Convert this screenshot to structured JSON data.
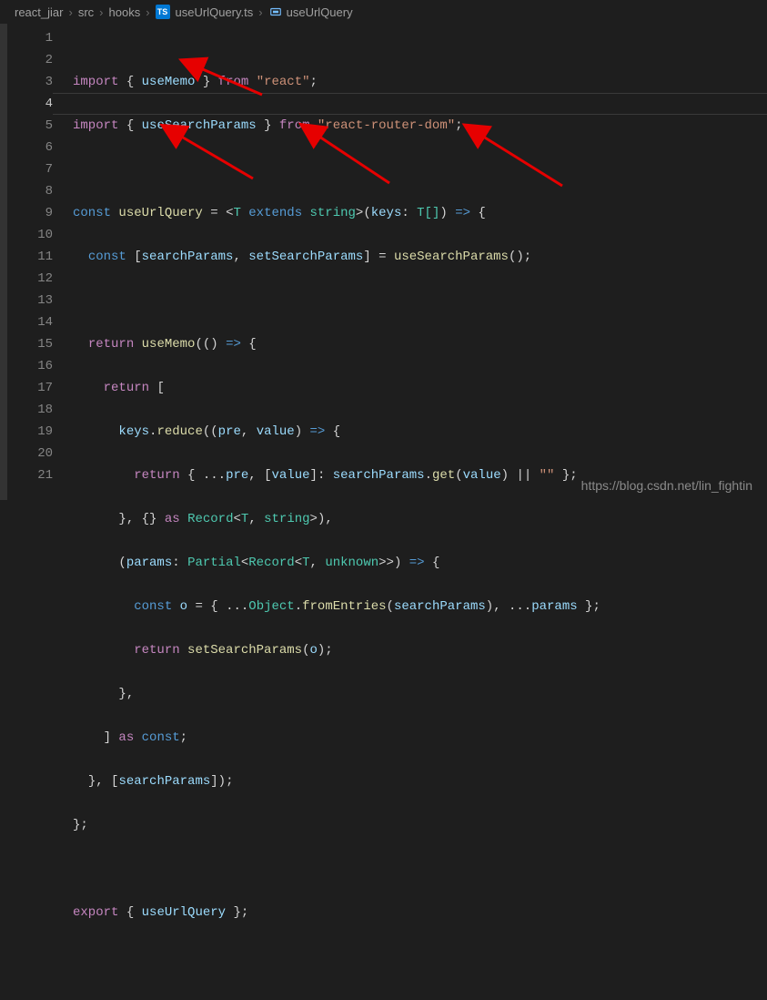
{
  "breadcrumb": {
    "parts": [
      "react_jiar",
      "src",
      "hooks"
    ],
    "file": "useUrlQuery.ts",
    "file_badge": "TS",
    "symbol": "useUrlQuery"
  },
  "active_line": 4,
  "lines": [
    "1",
    "2",
    "3",
    "4",
    "5",
    "6",
    "7",
    "8",
    "9",
    "10",
    "11",
    "12",
    "13",
    "14",
    "15",
    "16",
    "17",
    "18",
    "19",
    "20",
    "21"
  ],
  "t": {
    "import": "import",
    "from": "from",
    "const": "const",
    "return": "return",
    "extends": "extends",
    "as": "as",
    "export": "export",
    "ob": "{",
    "cb": "}",
    "osq": "[",
    "csq": "]",
    "op": "(",
    "cp": ")",
    "comma": ",",
    "semi": ";",
    "colon": ":",
    "arrow": "=>",
    "eq": "=",
    "lt": "<",
    "gt": ">",
    "spread": "...",
    "or": "||",
    "useMemo": "useMemo",
    "useSearchParams": "useSearchParams",
    "react": "\"react\"",
    "rrd": "\"react-router-dom\"",
    "useUrlQuery": "useUrlQuery",
    "T": "T",
    "string": "string",
    "keys": "keys",
    "Tarr": "T[]",
    "searchParams": "searchParams",
    "setSearchParams": "setSearchParams",
    "reduce": "reduce",
    "pre": "pre",
    "value": "value",
    "get": "get",
    "empty": "\"\"",
    "Record": "Record",
    "params": "params",
    "Partial": "Partial",
    "unknown": "unknown",
    "o": "o",
    "Object": "Object",
    "fromEntries": "fromEntries",
    "constk": "const"
  },
  "watermark": "https://blog.csdn.net/lin_fightin"
}
